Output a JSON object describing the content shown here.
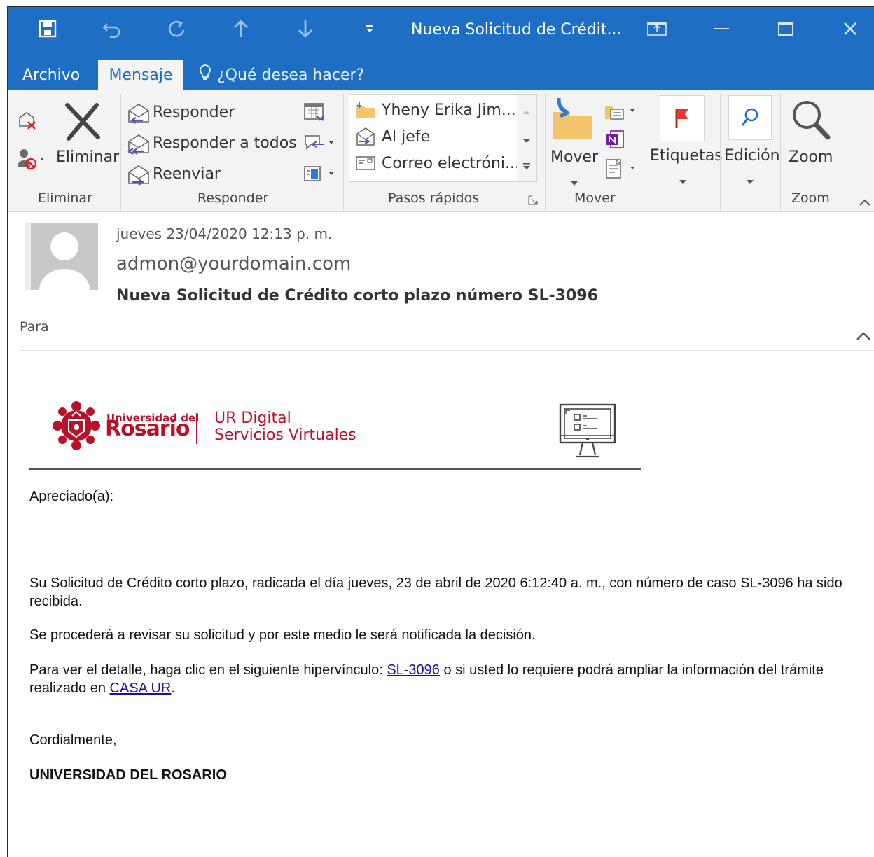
{
  "window": {
    "title": "Nueva Solicitud de Crédit...",
    "controls": [
      "restore-ribbon",
      "minimize",
      "maximize",
      "close"
    ]
  },
  "tabs": {
    "archivo": "Archivo",
    "mensaje": "Mensaje",
    "tell_me": "¿Qué desea hacer?"
  },
  "ribbon": {
    "eliminar_group": {
      "delete_label": "Eliminar",
      "group_label": "Eliminar"
    },
    "responder_group": {
      "reply": "Responder",
      "reply_all": "Responder a todos",
      "forward": "Reenviar",
      "group_label": "Responder"
    },
    "quick_steps": {
      "items": [
        "Yheny Erika Jim...",
        "Al jefe",
        "Correo electróni..."
      ],
      "group_label": "Pasos rápidos"
    },
    "mover_group": {
      "move_label": "Mover",
      "group_label": "Mover"
    },
    "tags_label": "Etiquetas",
    "editing_label": "Edición",
    "zoom_group": {
      "zoom_label": "Zoom",
      "group_label": "Zoom"
    }
  },
  "message_header": {
    "date": "jueves 23/04/2020 12:13 p. m.",
    "from": "admon@yourdomain.com",
    "subject": "Nueva Solicitud de Crédito corto plazo número SL-3096",
    "to_label": "Para"
  },
  "email_body": {
    "logo": {
      "university_small": "Universidad del",
      "university_big": "Rosario",
      "product_line1": "UR Digital",
      "product_line2": "Servicios Virtuales"
    },
    "greeting": "Apreciado(a):",
    "paragraph1": "Su Solicitud de Crédito corto plazo, radicada el día jueves, 23 de abril de 2020 6:12:40 a. m., con número de caso SL-3096 ha sido recibida.",
    "paragraph2": "Se procederá a revisar su solicitud y por este medio le será notificada la decisión.",
    "paragraph3_before": "Para ver el detalle, haga clic en el siguiente hipervínculo: ",
    "paragraph3_link1": "SL-3096",
    "paragraph3_middle": " o si usted lo requiere podrá ampliar la información del trámite realizado en ",
    "paragraph3_link2": "CASA UR",
    "paragraph3_after": ".",
    "closing": "Cordialmente,",
    "signature": "UNIVERSIDAD DEL ROSARIO"
  },
  "colors": {
    "titlebar": "#1e6fc4",
    "ribbon_bg": "#f3f3f3",
    "brand_red": "#b8122b",
    "link": "#1a0dab"
  }
}
